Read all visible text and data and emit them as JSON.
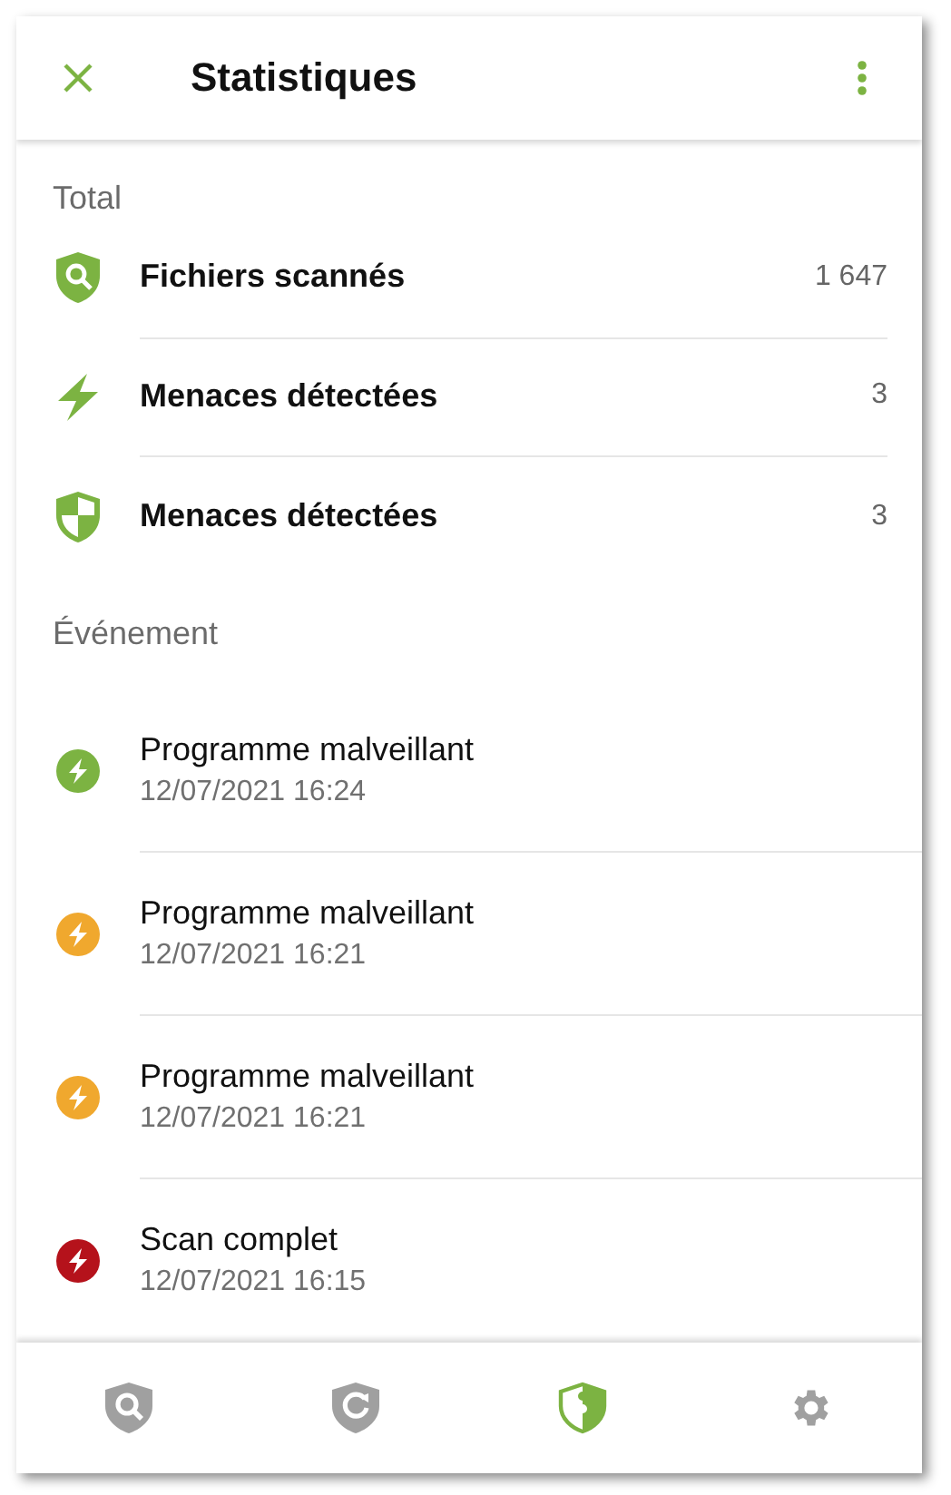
{
  "app_bar": {
    "title": "Statistiques"
  },
  "total": {
    "heading": "Total",
    "items": [
      {
        "kind": "scan",
        "label": "Fichiers scannés",
        "value": "1 647"
      },
      {
        "kind": "bolt",
        "label": "Menaces détectées",
        "value": "3"
      },
      {
        "kind": "shield",
        "label": "Menaces détectées",
        "value": "3"
      }
    ]
  },
  "events": {
    "heading": "Événement",
    "items": [
      {
        "title": "Programme malveillant",
        "time": "12/07/2021 16:24",
        "color": "#7cb342"
      },
      {
        "title": "Programme malveillant",
        "time": "12/07/2021 16:21",
        "color": "#f0a82e"
      },
      {
        "title": "Programme malveillant",
        "time": "12/07/2021 16:21",
        "color": "#f0a82e"
      },
      {
        "title": "Scan complet",
        "time": "12/07/2021 16:15",
        "color": "#b5121b"
      }
    ]
  },
  "bottom_nav": [
    {
      "kind": "scan",
      "selected": false
    },
    {
      "kind": "update",
      "selected": false
    },
    {
      "kind": "protection",
      "selected": true
    },
    {
      "kind": "settings",
      "selected": false
    }
  ]
}
